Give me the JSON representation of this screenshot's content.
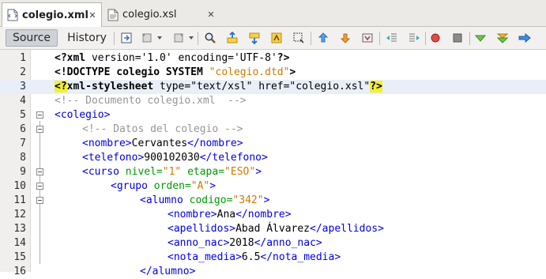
{
  "tabs": [
    {
      "label": "colegio.xml",
      "active": true
    },
    {
      "label": "colegio.xsl",
      "active": false
    }
  ],
  "toolbar": {
    "source_label": "Source",
    "history_label": "History",
    "icons": [
      "last-edit-icon",
      "back-icon",
      "forward-icon",
      "find-icon",
      "find-previous-icon",
      "find-next-icon",
      "toggle-highlight-icon",
      "find-selection-icon",
      "previous-bookmark-icon",
      "next-bookmark-icon",
      "toggle-bookmark-icon",
      "shift-left-icon",
      "shift-right-icon",
      "start-macro-icon",
      "stop-macro-icon",
      "check-xml-icon",
      "validate-xml-icon",
      "xsl-transform-icon"
    ]
  },
  "editor": {
    "highlighted_line": 3,
    "lines": [
      {
        "n": "1"
      },
      {
        "n": "2"
      },
      {
        "n": "3"
      },
      {
        "n": "4"
      },
      {
        "n": "5"
      },
      {
        "n": "6"
      },
      {
        "n": "7"
      },
      {
        "n": "8"
      },
      {
        "n": "9"
      },
      {
        "n": "10"
      },
      {
        "n": "11"
      },
      {
        "n": "12"
      },
      {
        "n": "13"
      },
      {
        "n": "14"
      },
      {
        "n": "15"
      },
      {
        "n": "16"
      }
    ],
    "tokens": {
      "l1_a": "<?xml",
      "l1_b": " version='1.0' encoding='UTF-8'",
      "l1_c": "?>",
      "l2_a": "<!DOCTYPE colegio SYSTEM ",
      "l2_b": "\"colegio.dtd\"",
      "l2_c": ">",
      "l3_a": "<?",
      "l3_b": "xml-stylesheet",
      "l3_c": " type=\"text/xsl\" href=\"colegio.xsl\"",
      "l3_d": "?>",
      "l4": "<!-- Documento colegio.xml  -->",
      "l5": "<colegio>",
      "l6": "<!-- Datos del colegio -->",
      "l7_open": "<nombre>",
      "l7_text": "Cervantes",
      "l7_close": "</nombre>",
      "l8_open": "<telefono>",
      "l8_text": "900102030",
      "l8_close": "</telefono>",
      "l9_a": "<curso",
      "l9_attr1": " nivel=",
      "l9_val1": "\"1\"",
      "l9_attr2": " etapa=",
      "l9_val2": "\"ESO\"",
      "l9_b": ">",
      "l10_a": "<grupo",
      "l10_attr": " orden=",
      "l10_val": "\"A\"",
      "l10_b": ">",
      "l11_a": "<alumno",
      "l11_attr": " codigo=",
      "l11_val": "\"342\"",
      "l11_b": ">",
      "l12_open": "<nombre>",
      "l12_text": "Ana",
      "l12_close": "</nombre>",
      "l13_open": "<apellidos>",
      "l13_text": "Abad Álvarez",
      "l13_close": "</apellidos>",
      "l14_open": "<anno_nac>",
      "l14_text": "2018",
      "l14_close": "</anno_nac>",
      "l15_open": "<nota_media>",
      "l15_text": "6.5",
      "l15_close": "</nota_media>",
      "l16": "</alumno>"
    }
  }
}
